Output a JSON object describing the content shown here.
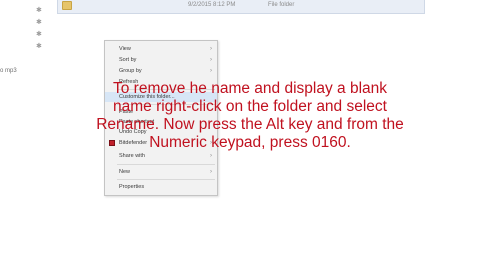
{
  "file_row": {
    "date": "9/2/2015 8:12 PM",
    "type": "File folder",
    "folder_icon": "folder-icon"
  },
  "sidebar": {
    "pin_glyph": "✱",
    "label": "o mp3"
  },
  "context_menu": {
    "items": [
      {
        "label": "View",
        "submenu": true
      },
      {
        "label": "Sort by",
        "submenu": true
      },
      {
        "label": "Group by",
        "submenu": true
      },
      {
        "label": "Refresh",
        "submenu": false
      },
      {
        "label": "Customize this folder...",
        "submenu": false
      },
      {
        "label": "Paste",
        "submenu": false
      },
      {
        "label": "Paste shortcut",
        "submenu": false
      },
      {
        "label": "Undo Copy",
        "submenu": false
      },
      {
        "label": "Bitdefender",
        "submenu": true
      },
      {
        "label": "Share with",
        "submenu": true
      },
      {
        "label": "New",
        "submenu": true
      },
      {
        "label": "Properties",
        "submenu": false
      }
    ],
    "arrow_glyph": "›",
    "bitdefender_icon": "bitdefender-icon"
  },
  "overlay": {
    "lines": [
      "To remove he name and display a blank",
      "name right-click on the folder and select",
      "Rename. Now press the Alt key and from the",
      "Numeric keypad, press 0160."
    ],
    "color": "#c0111f"
  }
}
